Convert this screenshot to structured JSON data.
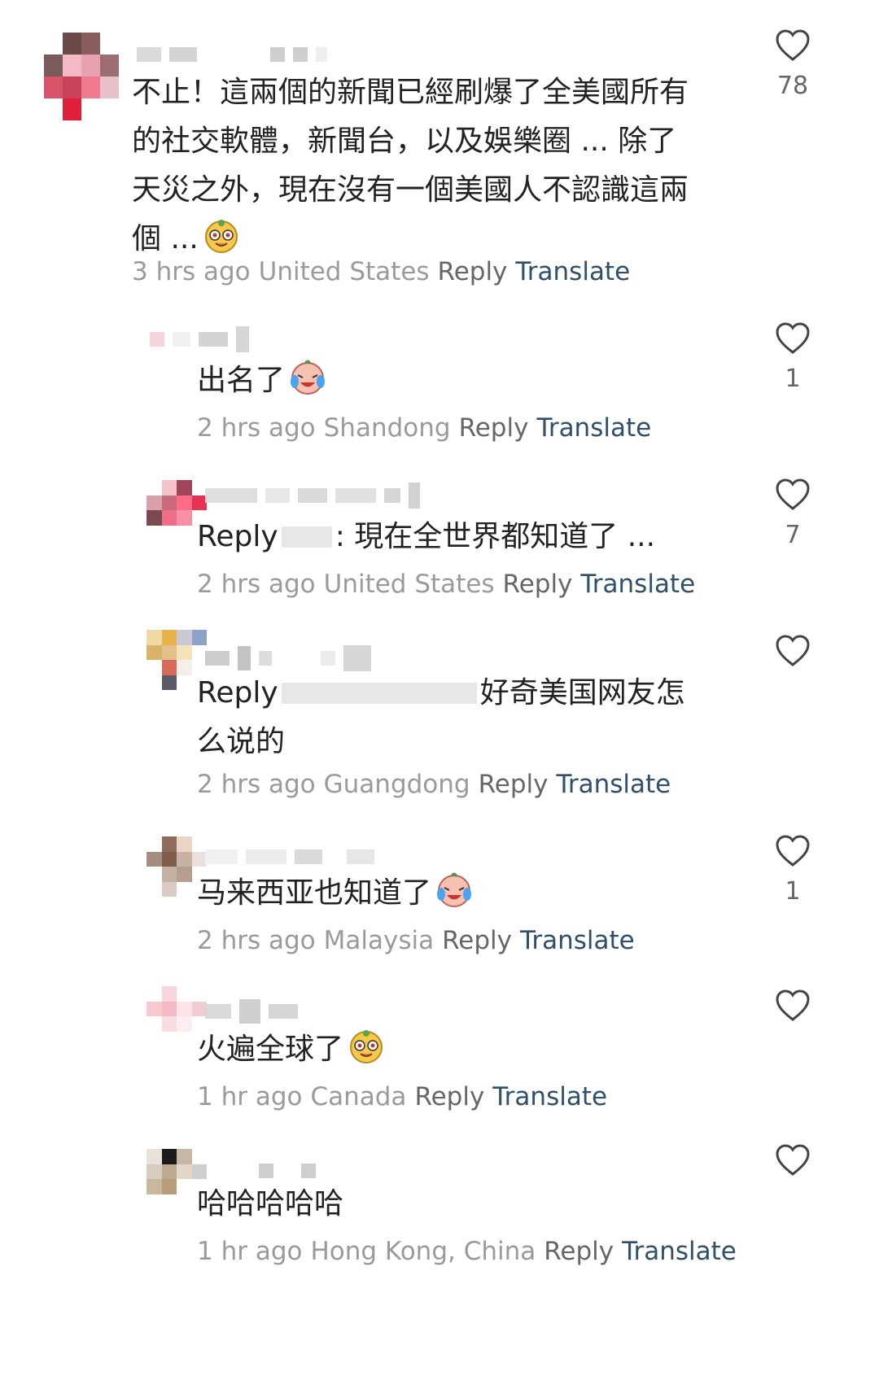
{
  "comments": [
    {
      "text": "不止！這兩個的新聞已經刷爆了全美國所有的社交軟體，新聞台，以及娛樂圈 ... 除了天災之外，現在沒有一個美國人不認識這兩個 ...",
      "time": "3 hrs ago",
      "location": "United States",
      "reply": "Reply",
      "translate": "Translate",
      "likes": "78",
      "emoji": "mole-grin-emoji"
    },
    {
      "text": "出名了",
      "time": "2 hrs ago",
      "location": "Shandong",
      "reply": "Reply",
      "translate": "Translate",
      "likes": "1",
      "emoji": "crying-laugh-emoji"
    },
    {
      "reply_prefix": "Reply",
      "text": ": 現在全世界都知道了 ...",
      "time": "2 hrs ago",
      "location": "United States",
      "reply": "Reply",
      "translate": "Translate",
      "likes": "7"
    },
    {
      "reply_prefix": "Reply",
      "text": "好奇美国网友怎么说的",
      "time": "2 hrs ago",
      "location": "Guangdong",
      "reply": "Reply",
      "translate": "Translate",
      "likes": ""
    },
    {
      "text": "马来西亚也知道了",
      "time": "2 hrs ago",
      "location": "Malaysia",
      "reply": "Reply",
      "translate": "Translate",
      "likes": "1",
      "emoji": "crying-laugh-emoji"
    },
    {
      "text": "火遍全球了",
      "time": "1 hr ago",
      "location": "Canada",
      "reply": "Reply",
      "translate": "Translate",
      "likes": "",
      "emoji": "mole-grin-emoji"
    },
    {
      "text": "哈哈哈哈哈",
      "time": "1 hr ago",
      "location": "Hong Kong, China",
      "reply": "Reply",
      "translate": "Translate",
      "likes": ""
    }
  ],
  "icons": {
    "like": "heart-outline-icon"
  },
  "colors": {
    "translate": "#2f4f6b",
    "meta": "#9a9a9a",
    "text": "#222222"
  }
}
